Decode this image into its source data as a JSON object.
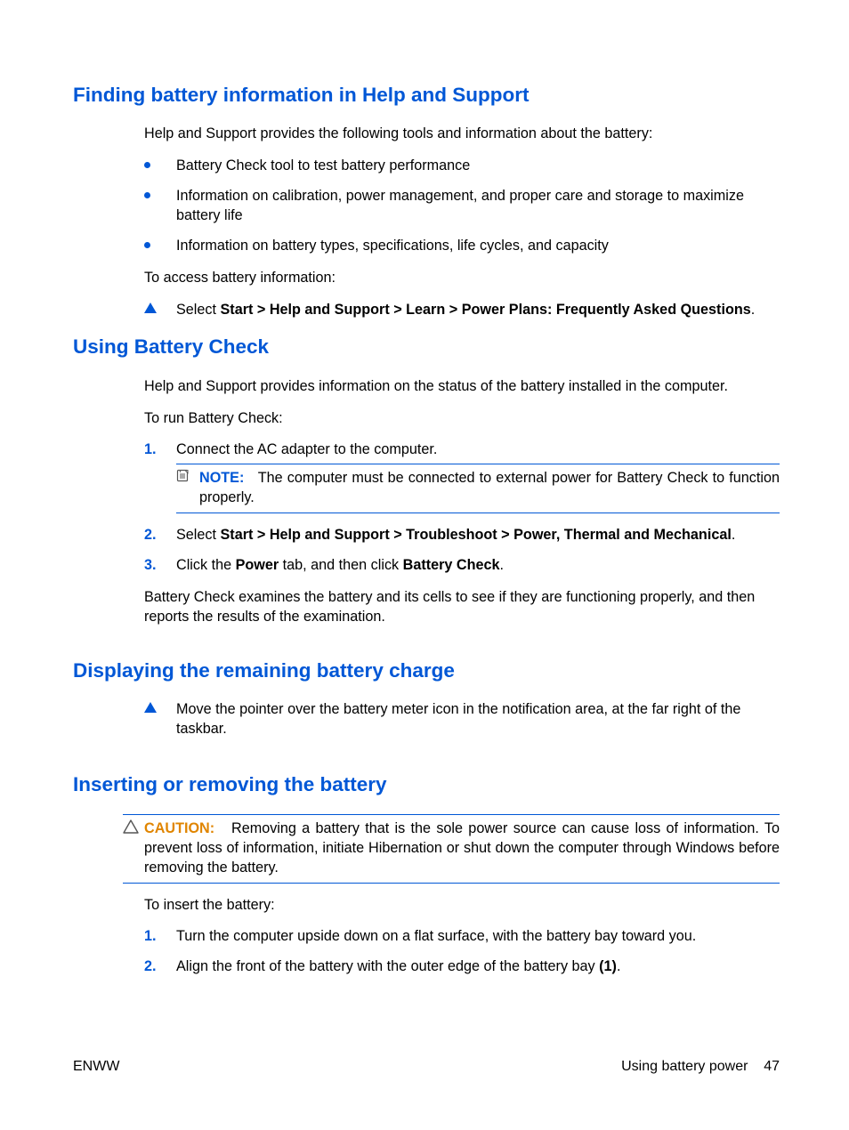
{
  "sections": {
    "s1": {
      "title": "Finding battery information in Help and Support",
      "intro": "Help and Support provides the following tools and information about the battery:",
      "bullets": [
        "Battery Check tool to test battery performance",
        "Information on calibration, power management, and proper care and storage to maximize battery life",
        "Information on battery types, specifications, life cycles, and capacity"
      ],
      "access": "To access battery information:",
      "step_prefix": "Select ",
      "step_bold": "Start > Help and Support > Learn > Power Plans: Frequently Asked Questions",
      "step_suffix": "."
    },
    "s2": {
      "title": "Using Battery Check",
      "intro": "Help and Support provides information on the status of the battery installed in the computer.",
      "run": "To run Battery Check:",
      "step1": "Connect the AC adapter to the computer.",
      "note_label": "NOTE:",
      "note_text": "The computer must be connected to external power for Battery Check to function properly.",
      "step2_prefix": "Select ",
      "step2_bold": "Start > Help and Support > Troubleshoot > Power, Thermal and Mechanical",
      "step2_suffix": ".",
      "step3_a": "Click the ",
      "step3_b": "Power",
      "step3_c": " tab, and then click ",
      "step3_d": "Battery Check",
      "step3_e": ".",
      "outro": "Battery Check examines the battery and its cells to see if they are functioning properly, and then reports the results of the examination."
    },
    "s3": {
      "title": "Displaying the remaining battery charge",
      "step": "Move the pointer over the battery meter icon in the notification area, at the far right of the taskbar."
    },
    "s4": {
      "title": "Inserting or removing the battery",
      "caution_label": "CAUTION:",
      "caution_text": "Removing a battery that is the sole power source can cause loss of information. To prevent loss of information, initiate Hibernation or shut down the computer through Windows before removing the battery.",
      "insert": "To insert the battery:",
      "step1": "Turn the computer upside down on a flat surface, with the battery bay toward you.",
      "step2_a": "Align the front of the battery with the outer edge of the battery bay ",
      "step2_b": "(1)",
      "step2_c": "."
    }
  },
  "footer": {
    "left": "ENWW",
    "right_label": "Using battery power",
    "page": "47"
  }
}
